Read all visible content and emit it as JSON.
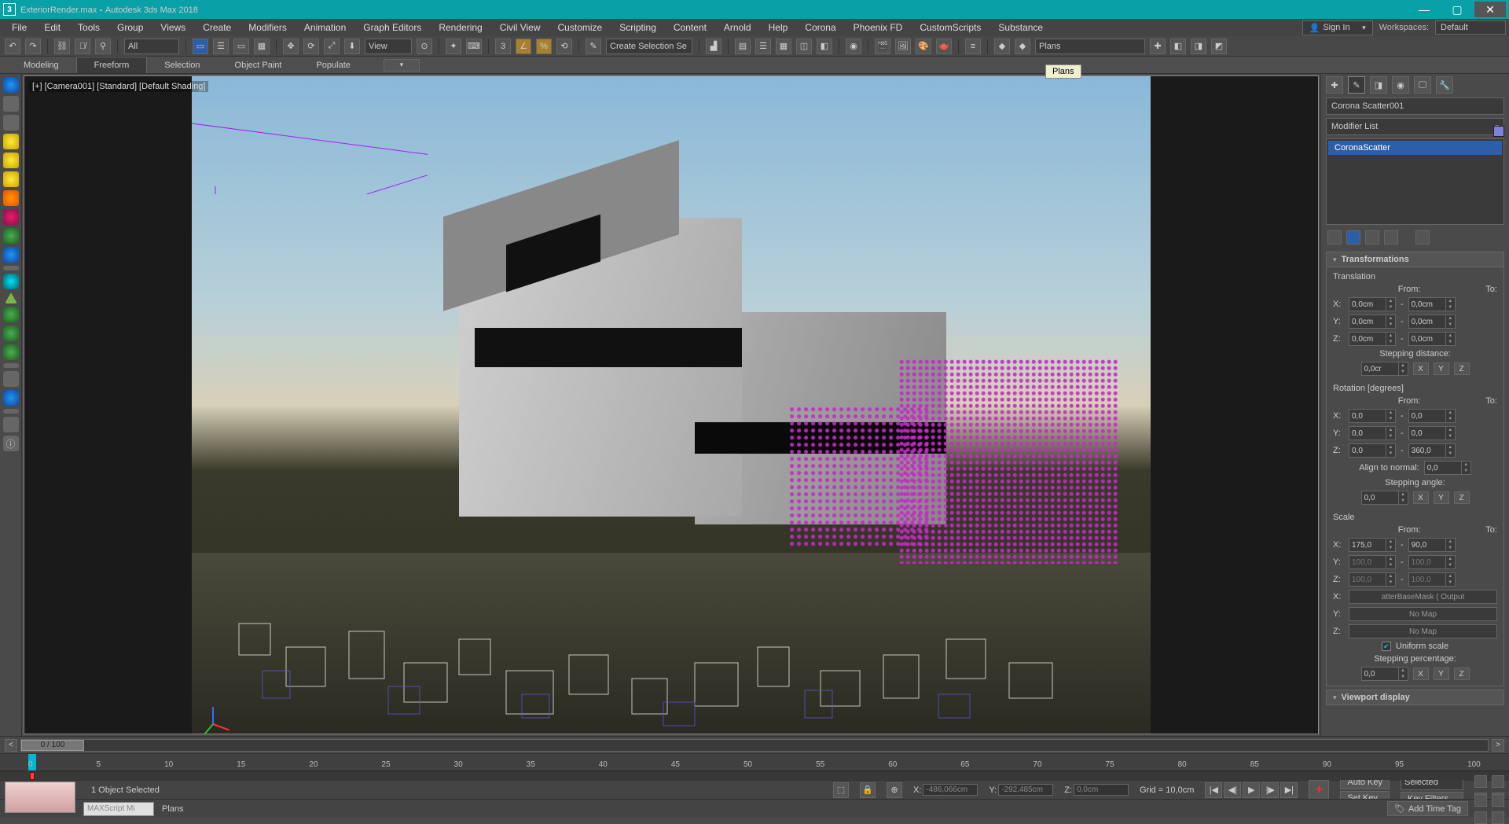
{
  "titlebar": {
    "filename": "ExteriorRender.max",
    "app": "Autodesk 3ds Max 2018"
  },
  "menus": [
    "File",
    "Edit",
    "Tools",
    "Group",
    "Views",
    "Create",
    "Modifiers",
    "Animation",
    "Graph Editors",
    "Rendering",
    "Civil View",
    "Customize",
    "Scripting",
    "Content",
    "Arnold",
    "Help",
    "Corona",
    "Phoenix FD",
    "CustomScripts",
    "Substance"
  ],
  "signin": "Sign In",
  "workspaces": {
    "label": "Workspaces:",
    "value": "Default"
  },
  "maintoolbar": {
    "all": "All",
    "view": "View",
    "selset": "Create Selection Se",
    "layerdd": "Plans"
  },
  "ribbon": {
    "tabs": [
      "Modeling",
      "Freeform",
      "Selection",
      "Object Paint",
      "Populate"
    ],
    "active": "Freeform",
    "tooltip": "Plans"
  },
  "viewport": {
    "label": "[+] [Camera001] [Standard] [Default Shading]"
  },
  "cmdpanel": {
    "objname": "Corona Scatter001",
    "modlist": "Modifier List",
    "stack": [
      "CoronaScatter"
    ],
    "transforms": {
      "header": "Transformations",
      "translation": {
        "label": "Translation",
        "from": "From:",
        "to": "To:",
        "x": "0,0cm",
        "y": "0,0cm",
        "z": "0,0cm",
        "sep": "-"
      },
      "stepdist": {
        "label": "Stepping distance:",
        "val": "0,0cr",
        "axes": [
          "X",
          "Y",
          "Z"
        ]
      },
      "rotation": {
        "label": "Rotation [degrees]",
        "x_from": "0,0",
        "x_to": "0,0",
        "y_from": "0,0",
        "y_to": "0,0",
        "z_from": "0,0",
        "z_to": "360,0"
      },
      "alignnormal": {
        "label": "Align to normal:",
        "val": "0,0"
      },
      "stepang": {
        "label": "Stepping angle:",
        "val": "0,0"
      },
      "scale": {
        "label": "Scale",
        "x_from": "175,0",
        "x_to": "90,0",
        "y_from": "100,0",
        "y_to": "100,0",
        "z_from": "100,0",
        "z_to": "100,0"
      },
      "maps": {
        "x": "atterBaseMask  ( Output",
        "y": "No Map",
        "z": "No Map"
      },
      "uniform": {
        "label": "Uniform scale",
        "checked": true
      },
      "steppct": {
        "label": "Stepping percentage:",
        "val": "0,0"
      }
    },
    "nextroll": "Viewport display"
  },
  "timeline": {
    "frame": "0 / 100"
  },
  "ruler": {
    "ticks": [
      "0",
      "5",
      "10",
      "15",
      "20",
      "25",
      "30",
      "35",
      "40",
      "45",
      "50",
      "55",
      "60",
      "65",
      "70",
      "75",
      "80",
      "85",
      "90",
      "95",
      "100"
    ]
  },
  "status": {
    "selected": "1 Object Selected",
    "layer": "Plans",
    "x_lbl": "X:",
    "x": "-486,066cm",
    "y_lbl": "Y:",
    "y": "-292,485cm",
    "z_lbl": "Z:",
    "z": "0,0cm",
    "grid": "Grid = 10,0cm",
    "autokey": "Auto Key",
    "setkey": "Set Key",
    "selected_dd": "Selected",
    "keyfilters": "Key Filters...",
    "addtag": "Add Time Tag",
    "maxscript": "MAXScript Mi"
  }
}
